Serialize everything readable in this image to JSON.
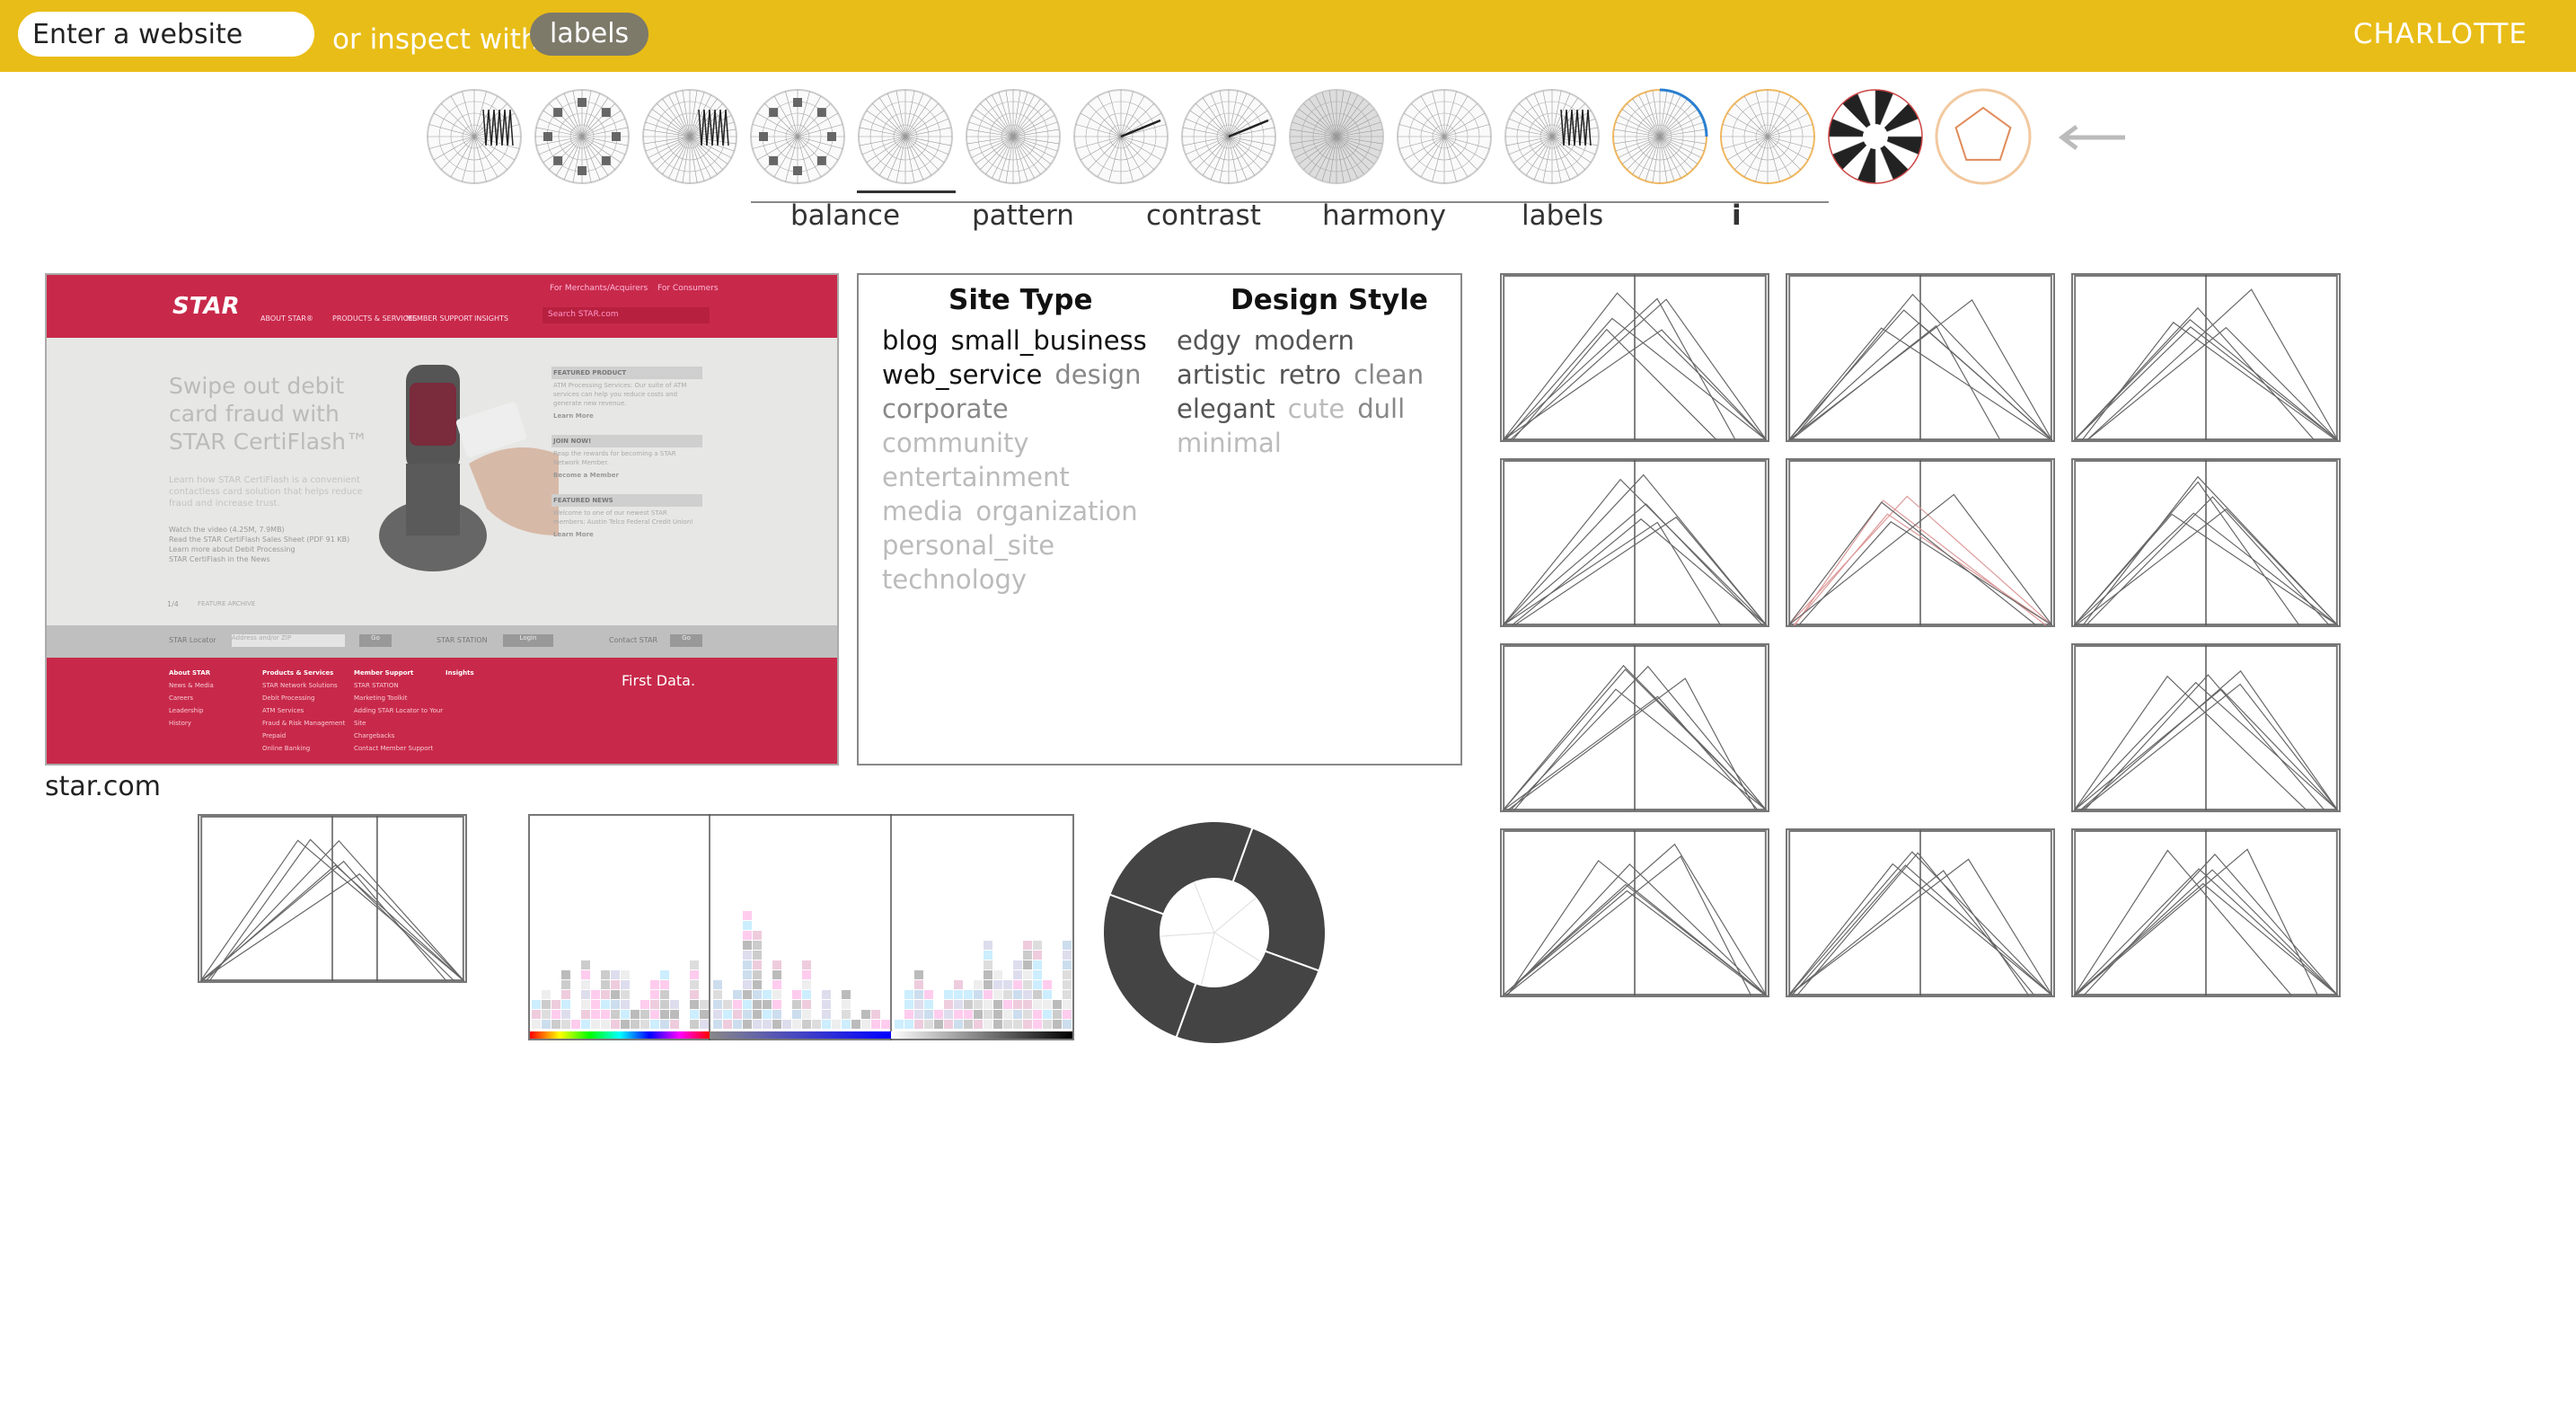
{
  "header": {
    "search_placeholder": "Enter a website",
    "or_text": "or inspect with",
    "labels_button": "labels",
    "brand": "CHARLOTTE",
    "bar_color": "#e9bd17"
  },
  "glyph_icons": [
    "radial-glyph",
    "radial-glyph",
    "radial-glyph",
    "radial-glyph",
    "radial-glyph",
    "radial-glyph",
    "radial-glyph",
    "radial-glyph",
    "radial-glyph",
    "radial-glyph",
    "radial-glyph",
    "radial-glyph",
    "radial-glyph",
    "radial-glyph",
    "radial-glyph"
  ],
  "tabs": [
    "balance",
    "pattern",
    "contrast",
    "harmony",
    "labels",
    "i"
  ],
  "active_tab": "pattern",
  "preview": {
    "caption": "star.com",
    "nav_links": [
      "For Merchants/Acquirers",
      "For Consumers"
    ],
    "logo": "STAR",
    "menu": [
      "ABOUT STAR®",
      "PRODUCTS & SERVICES",
      "MEMBER SUPPORT",
      "INSIGHTS"
    ],
    "search": "Search STAR.com",
    "hero_title": "Swipe out debit card fraud with STAR CertiFlash™",
    "hero_body": "Learn how STAR CertiFlash is a convenient contactless card solution that helps reduce fraud and increase trust.",
    "hero_links": [
      "Watch the video (4.25M, 7.9MB)",
      "Read the STAR CertiFlash Sales Sheet (PDF 91 KB)",
      "Learn more about Debit Processing",
      "STAR CertiFlash in the News"
    ],
    "side_blocks": [
      {
        "head": "FEATURED PRODUCT",
        "body": "ATM Processing Services: Our suite of ATM services can help you reduce costs and generate new revenue.",
        "link": "Learn More"
      },
      {
        "head": "JOIN NOW!",
        "body": "Reap the rewards for becoming a STAR Network Member.",
        "link": "Become a Member"
      },
      {
        "head": "FEATURED NEWS",
        "body": "Welcome to one of our newest STAR members: Austin Telco Federal Credit Union!",
        "link": "Learn More"
      }
    ],
    "pager": "1/4",
    "pager_label": "FEATURE ARCHIVE",
    "bottom_bar": [
      "STAR Locator",
      "Address and/or ZIP",
      "Go",
      "STAR STATION",
      "Login",
      "Contact STAR",
      "Go"
    ],
    "footer_cols": [
      {
        "head": "About STAR",
        "items": [
          "News & Media",
          "Careers",
          "Leadership",
          "History"
        ]
      },
      {
        "head": "Products & Services",
        "items": [
          "STAR Network Solutions",
          "Debit Processing",
          "ATM Services",
          "Fraud & Risk Management",
          "Prepaid",
          "Online Banking"
        ]
      },
      {
        "head": "Member Support",
        "items": [
          "STAR STATION",
          "Marketing Toolkit",
          "Adding STAR Locator to Your Site",
          "Chargebacks",
          "Contact Member Support"
        ]
      },
      {
        "head": "Insights",
        "items": []
      }
    ],
    "footer_brand": "First Data."
  },
  "tags": {
    "site_type_title": "Site Type",
    "design_style_title": "Design Style",
    "site_type_lines": [
      [
        {
          "t": "blog",
          "w": 0
        },
        {
          "t": "small_business",
          "w": 0
        }
      ],
      [
        {
          "t": "web_service",
          "w": 0
        },
        {
          "t": "design",
          "w": 2
        }
      ],
      [
        {
          "t": "corporate",
          "w": 2
        }
      ],
      [
        {
          "t": "community",
          "w": 3
        }
      ],
      [
        {
          "t": "entertainment",
          "w": 3
        }
      ],
      [
        {
          "t": "media",
          "w": 3
        },
        {
          "t": "organization",
          "w": 3
        }
      ],
      [
        {
          "t": "personal_site",
          "w": 3
        }
      ],
      [
        {
          "t": "technology",
          "w": 3
        }
      ]
    ],
    "design_style_lines": [
      [
        {
          "t": "edgy",
          "w": 1
        },
        {
          "t": "modern",
          "w": 1
        }
      ],
      [
        {
          "t": "artistic",
          "w": 1
        },
        {
          "t": "retro",
          "w": 1
        },
        {
          "t": "clean",
          "w": 2
        }
      ],
      [
        {
          "t": "elegant",
          "w": 1
        },
        {
          "t": "cute",
          "w": 3
        },
        {
          "t": "dull",
          "w": 2
        }
      ],
      [
        {
          "t": "minimal",
          "w": 3
        }
      ]
    ]
  },
  "donut": {
    "outer_color": "#444",
    "inner_color": "#444",
    "segments": 4
  }
}
